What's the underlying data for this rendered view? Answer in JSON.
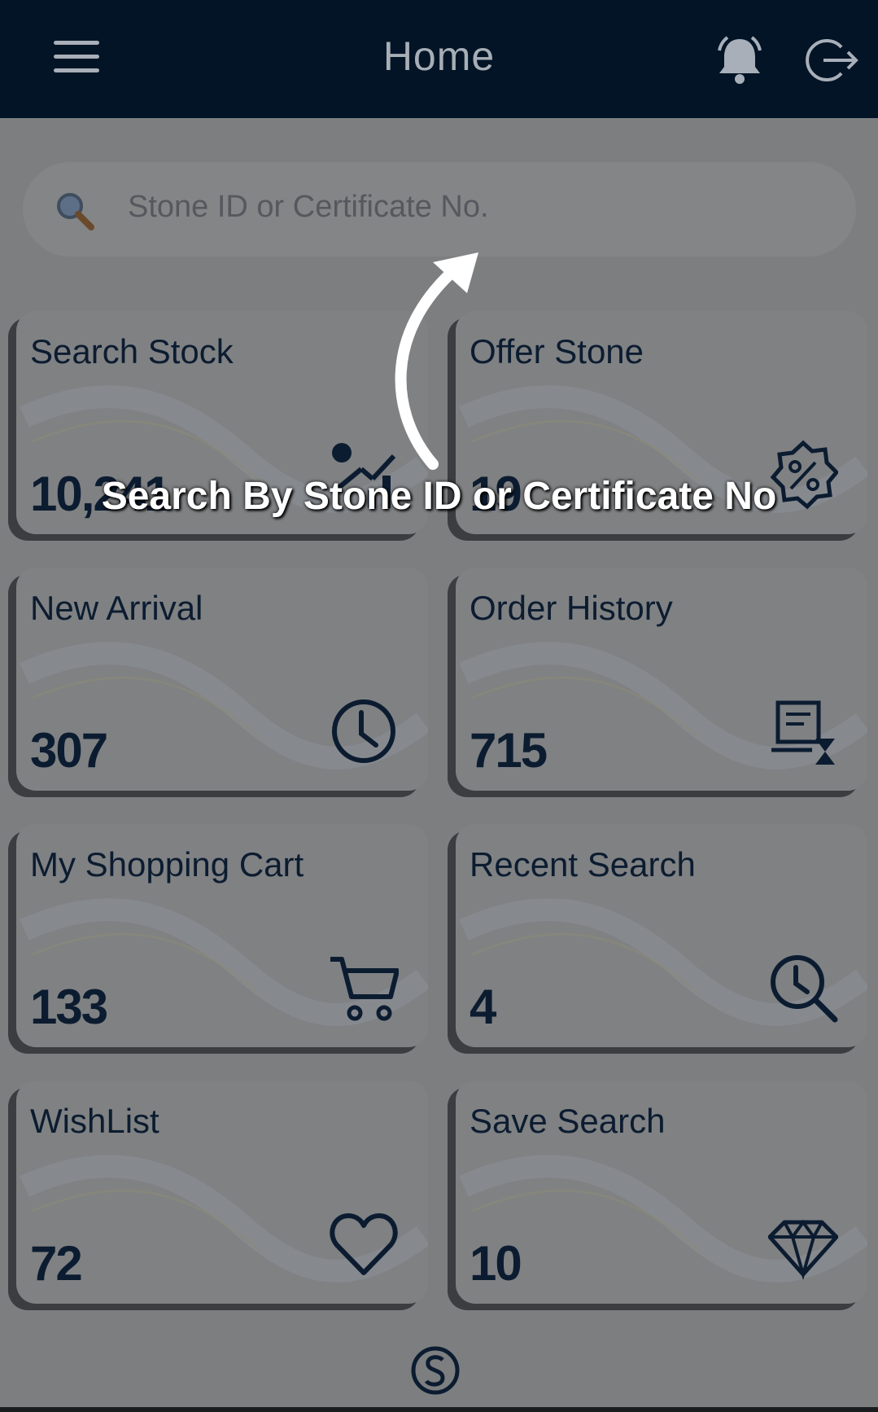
{
  "header": {
    "title": "Home",
    "menu_icon": "hamburger-icon",
    "notification_icon": "bell-icon",
    "logout_icon": "logout-icon"
  },
  "search": {
    "placeholder": "Stone ID or Certificate No.",
    "icon": "search-icon"
  },
  "tiles": [
    {
      "label": "Search Stock",
      "count": "10,241",
      "icon": "stock-chart-icon"
    },
    {
      "label": "Offer Stone",
      "count": "19",
      "icon": "percent-badge-icon"
    },
    {
      "label": "New Arrival",
      "count": "307",
      "icon": "clock-icon"
    },
    {
      "label": "Order History",
      "count": "715",
      "icon": "order-history-icon"
    },
    {
      "label": "My Shopping Cart",
      "count": "133",
      "icon": "cart-icon"
    },
    {
      "label": "Recent Search",
      "count": "4",
      "icon": "recent-search-icon"
    },
    {
      "label": "WishList",
      "count": "72",
      "icon": "heart-icon"
    },
    {
      "label": "Save Search",
      "count": "10",
      "icon": "diamond-icon"
    }
  ],
  "coachmark": {
    "text": "Search By Stone ID or Certificate No",
    "icon": "curved-arrow-icon"
  },
  "footer": {
    "logo": "brand-logo-icon"
  },
  "colors": {
    "header_bg": "#021426",
    "text_dark": "#0c1c30",
    "overlay_text": "#ffffff"
  }
}
